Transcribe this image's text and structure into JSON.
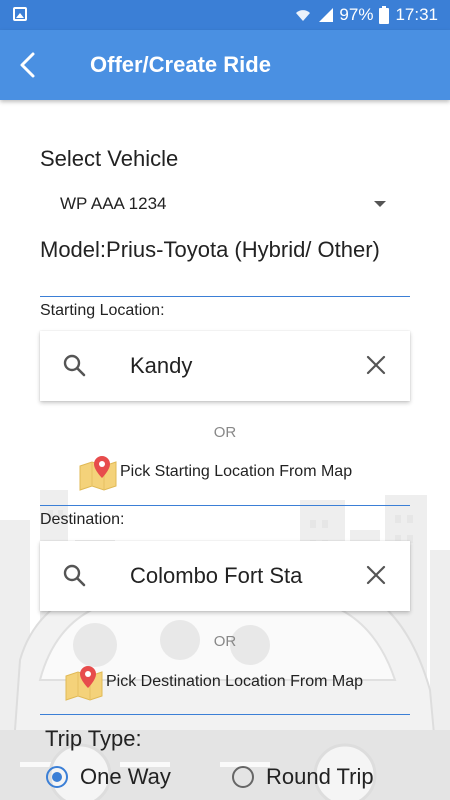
{
  "status_bar": {
    "battery": "97%",
    "time": "17:31"
  },
  "app_bar": {
    "title": "Offer/Create Ride"
  },
  "form": {
    "select_vehicle_label": "Select Vehicle",
    "vehicle_value": "WP AAA 1234",
    "model_text": "Model:Prius-Toyota (Hybrid/ Other)",
    "starting_location_label": "Starting Location:",
    "starting_location_value": "Kandy",
    "or_text": "OR",
    "pick_start_label": "Pick Starting Location From Map",
    "destination_label": "Destination:",
    "destination_value": "Colombo Fort Sta",
    "pick_dest_label": "Pick Destination Location From Map",
    "trip_type_label": "Trip Type:",
    "trip_options": [
      {
        "label": "One Way",
        "selected": true
      },
      {
        "label": "Round Trip",
        "selected": false
      }
    ]
  },
  "colors": {
    "primary": "#4a90e2",
    "status_bar": "#3b7fd6",
    "accent": "#3b7fd6"
  }
}
